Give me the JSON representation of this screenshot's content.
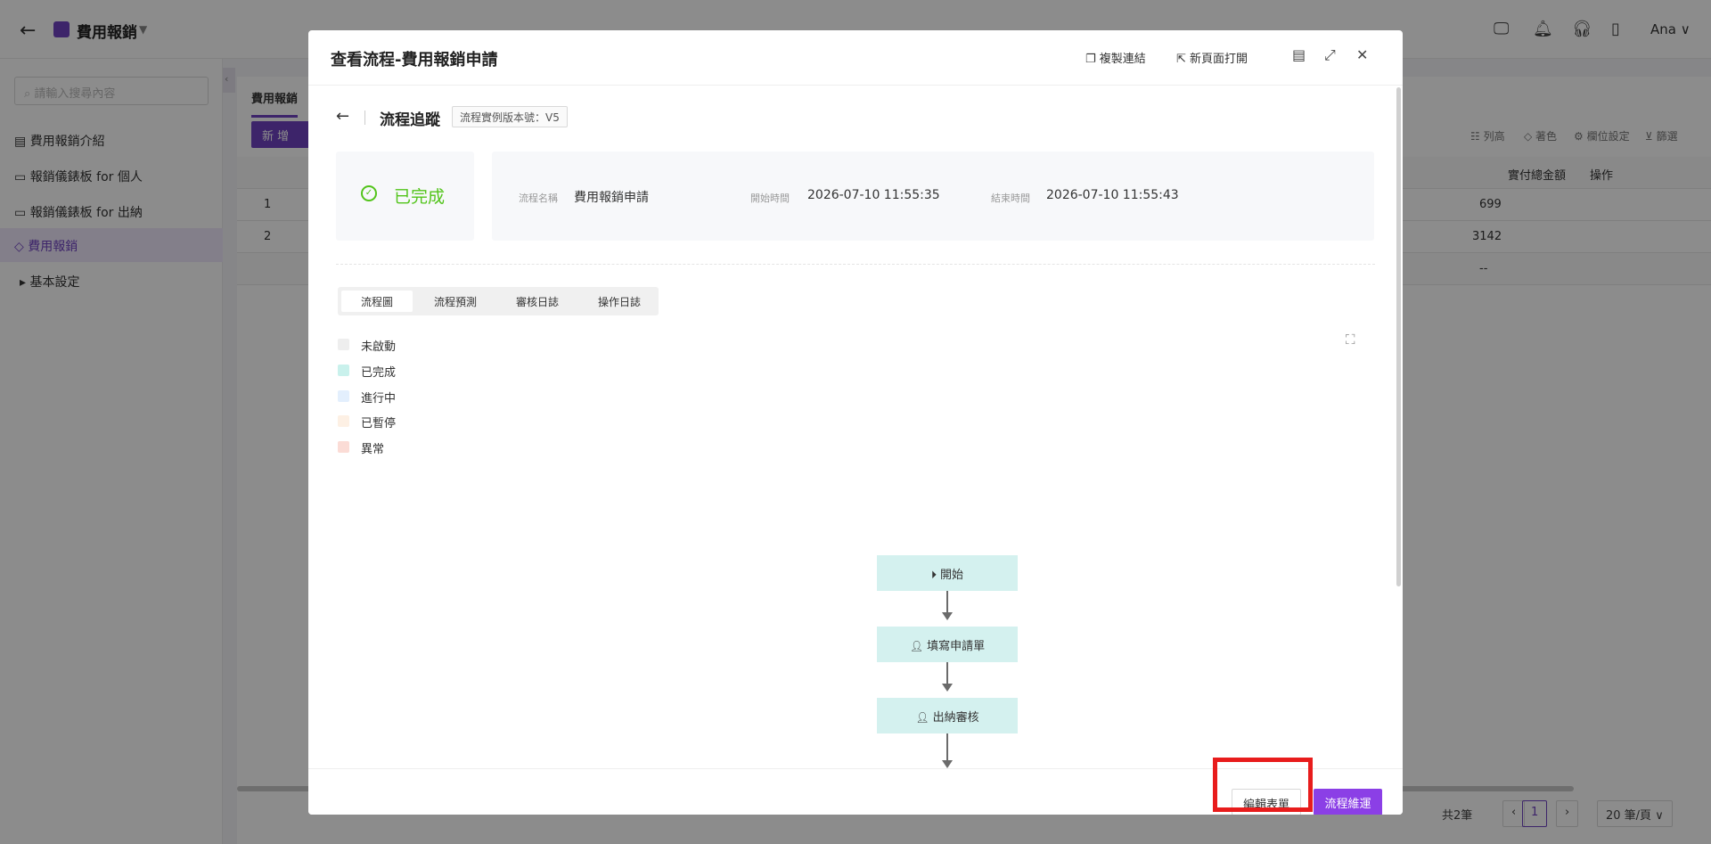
{
  "topbar": {
    "app_title": "費用報銷",
    "user": "Ana"
  },
  "sidebar": {
    "search_placeholder": "請輸入搜尋內容",
    "items": [
      {
        "label": "費用報銷介紹"
      },
      {
        "label": "報銷儀錶板 for 個人"
      },
      {
        "label": "報銷儀錶板 for 出納"
      },
      {
        "label": "費用報銷"
      },
      {
        "label": "基本設定"
      }
    ]
  },
  "content": {
    "tab": "費用報銷",
    "add_button": "新 增",
    "tools": [
      "列高",
      "著色",
      "欄位設定",
      "篩選"
    ],
    "columns": [
      "實付總金額",
      "操作"
    ],
    "rows": [
      {
        "index": "1",
        "amount": "699"
      },
      {
        "index": "2",
        "amount": "3142"
      }
    ],
    "summary": "--",
    "pager": {
      "total": "共2筆",
      "page": "1",
      "page_size": "20 筆/頁"
    }
  },
  "modal": {
    "title": "查看流程-費用報銷申請",
    "copy_link": "複製連結",
    "open_new_page": "新頁面打開",
    "tracking_title": "流程追蹤",
    "version_tag": "流程實例版本號：V5",
    "status": "已完成",
    "info": {
      "name_label": "流程名稱",
      "name_value": "費用報銷申請",
      "start_label": "開始時間",
      "start_value": "2026-07-10 11:55:35",
      "end_label": "結束時間",
      "end_value": "2026-07-10 11:55:43"
    },
    "tabs": [
      "流程圖",
      "流程預測",
      "審核日誌",
      "操作日誌"
    ],
    "legend": [
      {
        "label": "未啟動",
        "color": "#eeeeee"
      },
      {
        "label": "已完成",
        "color": "#c9f1ec"
      },
      {
        "label": "進行中",
        "color": "#e3effd"
      },
      {
        "label": "已暫停",
        "color": "#fdf0e4"
      },
      {
        "label": "異常",
        "color": "#fbdcd6"
      }
    ],
    "flow_nodes": [
      "開始",
      "填寫申請單",
      "出納審核"
    ],
    "footer": {
      "edit_form": "編輯表單",
      "continue_flow": "流程維運"
    }
  },
  "colors": {
    "accent": "#8b3fe6",
    "success": "#52c41a",
    "node_fill": "#d4f1ef",
    "highlight": "#e81c1c"
  }
}
